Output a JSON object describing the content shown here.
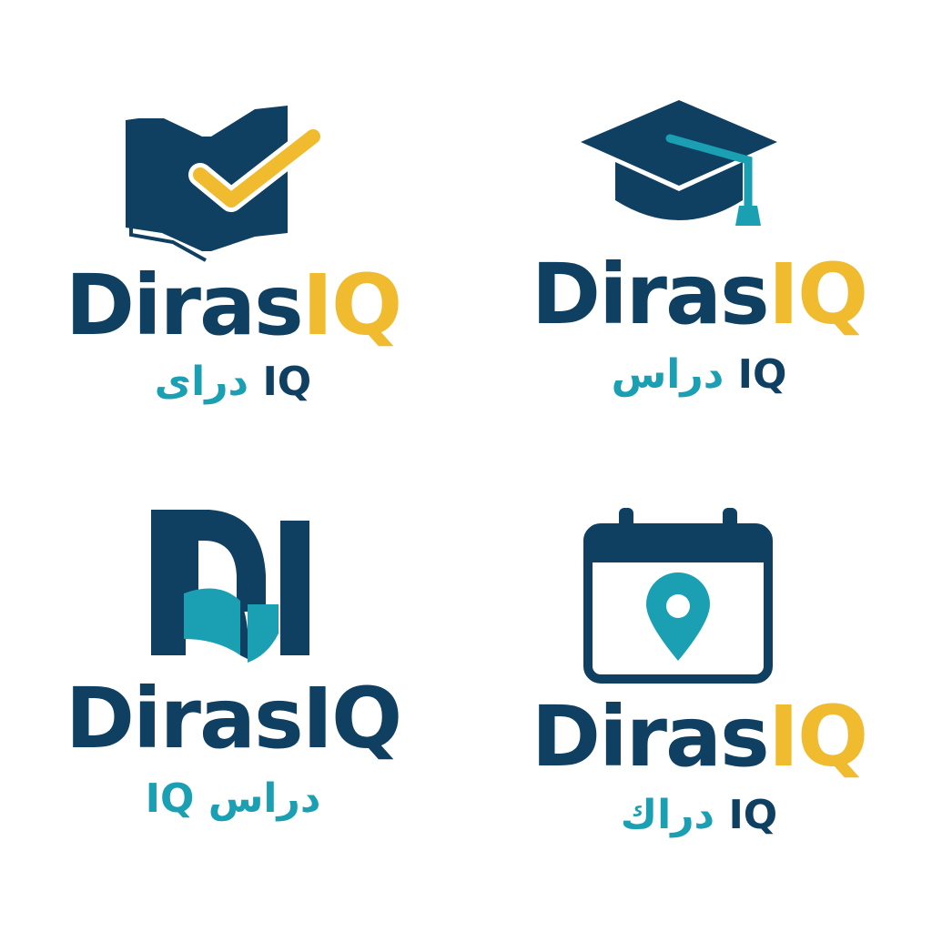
{
  "colors": {
    "navy": "#0f3f61",
    "gold": "#f1bb2f",
    "teal": "#1a9fb3",
    "background": "#ffffff"
  },
  "logos": [
    {
      "icon": "open-book-checkmark-icon",
      "brand_first": "Diras",
      "brand_second": "IQ",
      "accent": "#f1bb2f",
      "arabic_latin": "IQ",
      "arabic_text": "دراى"
    },
    {
      "icon": "graduation-cap-icon",
      "brand_first": "Diras",
      "brand_second": "IQ",
      "accent": "#f1bb2f",
      "arabic_latin": "IQ",
      "arabic_text": "دراس"
    },
    {
      "icon": "di-monogram-icon",
      "brand_first": "Diras",
      "brand_second": "IQ",
      "accent": "#0f3f61",
      "arabic_latin": "IQ",
      "arabic_text": "دراس"
    },
    {
      "icon": "calendar-location-pin-icon",
      "brand_first": "Diras",
      "brand_second": "IQ",
      "accent": "#f1bb2f",
      "arabic_latin": "IQ",
      "arabic_text": "دراك"
    }
  ]
}
